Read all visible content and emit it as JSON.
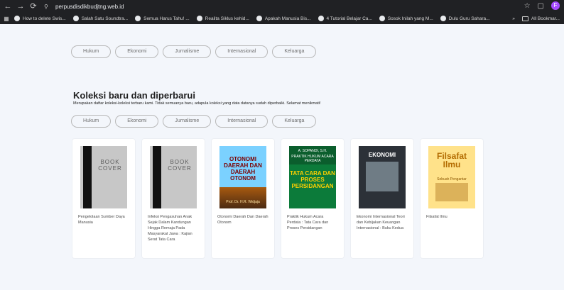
{
  "browser": {
    "url": "perpusdisdikbudjtng.web.id",
    "profile_initial": "F",
    "bookmarks_visible": [
      "How to delete Swis...",
      "Salah Satu Soundtra...",
      "Semua Harus Tahu! ...",
      "Realita Siklus kehid...",
      "Apakah Manusia Bis...",
      "4 Tutorial Belajar Ca...",
      "Sosok Inilah yang M...",
      "Dulu Guru Sahara..."
    ],
    "bookmarks_overflow": "»",
    "all_bookmarks": "All Bookmar..."
  },
  "top_filters": [
    "Hukum",
    "Ekonomi",
    "Jurnalisme",
    "Internasional",
    "Keluarga"
  ],
  "section": {
    "title": "Koleksi baru dan diperbarui",
    "description": "Merupakan daftar koleksi-koleksi terbaru kami. Tidak semuanya baru, adapula koleksi yang data datanya sudah diperbaiki. Selamat menikmati!",
    "filters": [
      "Hukum",
      "Ekonomi",
      "Jurnalisme",
      "Internasional",
      "Keluarga"
    ]
  },
  "books": [
    {
      "title": "Pengelolaan Sumber Daya Manusia",
      "cover": {
        "kind": "placeholder",
        "text": "BOOK COVER"
      }
    },
    {
      "title": "Infeksi Pengasuhan Anak Sejak Dalam Kandungan Hingga Remaja Pada Masyarakat Jawa : Kajian Serat Tata Cara",
      "cover": {
        "kind": "placeholder",
        "text": "BOOK COVER"
      }
    },
    {
      "title": "Otonomi Daerah Dan Daerah Otonom",
      "cover": {
        "kind": "otonomi",
        "text": "OTONOMI DAERAH DAN DAERAH OTONOM",
        "author": "Prof. Dr. H.R. Widjaja"
      }
    },
    {
      "title": "Praktik Hukum Acara Perdata : Tata Cara dan Proses Persidangan",
      "cover": {
        "kind": "tatacara",
        "text_small": "A. SOPANDI, S.H.",
        "text_small2": "PRAKTIK HUKUM ACARA PERDATA",
        "text": "TATA CARA DAN PROSES PERSIDANGAN"
      }
    },
    {
      "title": "Ekonomi Internasional Teori dan Kebijakan Keuangan Internasional : Buku Kedua",
      "cover": {
        "kind": "ekonomi",
        "text": "EKONOMI"
      }
    },
    {
      "title": "Filsafat Ilmu",
      "cover": {
        "kind": "filsafat",
        "text": "Filsafat Ilmu",
        "sub": "Sebuah Pengantar"
      }
    }
  ]
}
